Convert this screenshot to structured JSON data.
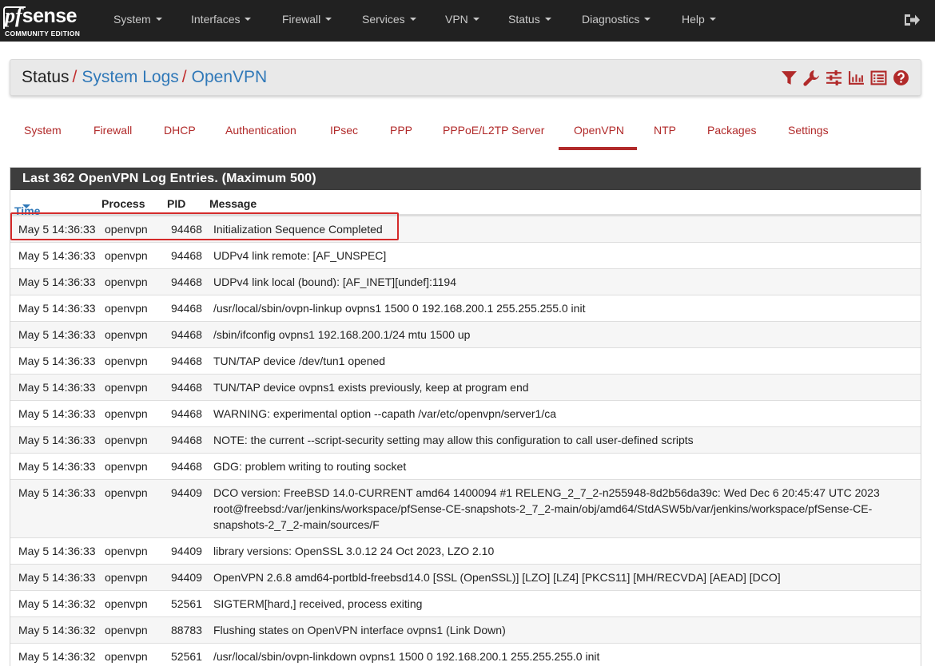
{
  "navbar": {
    "logo_main_pf": "pf",
    "logo_main_sense": "sense",
    "logo_sub": "COMMUNITY EDITION",
    "items": [
      "System",
      "Interfaces",
      "Firewall",
      "Services",
      "VPN",
      "Status",
      "Diagnostics",
      "Help"
    ],
    "logout_icon": "sign-out-icon"
  },
  "breadcrumb": {
    "root": "Status",
    "separator": "/",
    "level1": "System Logs",
    "level2": "OpenVPN",
    "icons": [
      "filter-icon",
      "wrench-icon",
      "sliders-icon",
      "bar-chart-icon",
      "list-icon",
      "question-circle-icon"
    ]
  },
  "tabs": {
    "items": [
      "System",
      "Firewall",
      "DHCP",
      "Authentication",
      "IPsec",
      "PPP",
      "PPPoE/L2TP Server",
      "OpenVPN",
      "NTP",
      "Packages",
      "Settings"
    ],
    "active": "OpenVPN"
  },
  "log": {
    "heading": "Last 362 OpenVPN Log Entries. (Maximum 500)",
    "columns": {
      "time": "Time",
      "process": "Process",
      "pid": "PID",
      "message": "Message"
    },
    "rows": [
      {
        "time": "May 5 14:36:33",
        "process": "openvpn",
        "pid": "94468",
        "message": "Initialization Sequence Completed"
      },
      {
        "time": "May 5 14:36:33",
        "process": "openvpn",
        "pid": "94468",
        "message": "UDPv4 link remote: [AF_UNSPEC]"
      },
      {
        "time": "May 5 14:36:33",
        "process": "openvpn",
        "pid": "94468",
        "message": "UDPv4 link local (bound): [AF_INET][undef]:1194"
      },
      {
        "time": "May 5 14:36:33",
        "process": "openvpn",
        "pid": "94468",
        "message": "/usr/local/sbin/ovpn-linkup ovpns1 1500 0 192.168.200.1 255.255.255.0 init"
      },
      {
        "time": "May 5 14:36:33",
        "process": "openvpn",
        "pid": "94468",
        "message": "/sbin/ifconfig ovpns1 192.168.200.1/24 mtu 1500 up"
      },
      {
        "time": "May 5 14:36:33",
        "process": "openvpn",
        "pid": "94468",
        "message": "TUN/TAP device /dev/tun1 opened"
      },
      {
        "time": "May 5 14:36:33",
        "process": "openvpn",
        "pid": "94468",
        "message": "TUN/TAP device ovpns1 exists previously, keep at program end"
      },
      {
        "time": "May 5 14:36:33",
        "process": "openvpn",
        "pid": "94468",
        "message": "WARNING: experimental option --capath /var/etc/openvpn/server1/ca"
      },
      {
        "time": "May 5 14:36:33",
        "process": "openvpn",
        "pid": "94468",
        "message": "NOTE: the current --script-security setting may allow this configuration to call user-defined scripts"
      },
      {
        "time": "May 5 14:36:33",
        "process": "openvpn",
        "pid": "94468",
        "message": "GDG: problem writing to routing socket"
      },
      {
        "time": "May 5 14:36:33",
        "process": "openvpn",
        "pid": "94409",
        "message": "DCO version: FreeBSD 14.0-CURRENT amd64 1400094 #1 RELENG_2_7_2-n255948-8d2b56da39c: Wed Dec 6 20:45:47 UTC 2023 root@freebsd:/var/jenkins/workspace/pfSense-CE-snapshots-2_7_2-main/obj/amd64/StdASW5b/var/jenkins/workspace/pfSense-CE-snapshots-2_7_2-main/sources/F"
      },
      {
        "time": "May 5 14:36:33",
        "process": "openvpn",
        "pid": "94409",
        "message": "library versions: OpenSSL 3.0.12 24 Oct 2023, LZO 2.10"
      },
      {
        "time": "May 5 14:36:33",
        "process": "openvpn",
        "pid": "94409",
        "message": "OpenVPN 2.6.8 amd64-portbld-freebsd14.0 [SSL (OpenSSL)] [LZO] [LZ4] [PKCS11] [MH/RECVDA] [AEAD] [DCO]"
      },
      {
        "time": "May 5 14:36:32",
        "process": "openvpn",
        "pid": "52561",
        "message": "SIGTERM[hard,] received, process exiting"
      },
      {
        "time": "May 5 14:36:32",
        "process": "openvpn",
        "pid": "88783",
        "message": "Flushing states on OpenVPN interface ovpns1 (Link Down)"
      },
      {
        "time": "May 5 14:36:32",
        "process": "openvpn",
        "pid": "52561",
        "message": "/usr/local/sbin/ovpn-linkdown ovpns1 1500 0 192.168.200.1 255.255.255.0 init"
      }
    ]
  },
  "colors": {
    "navbar_bg": "#212121",
    "accent_red": "#b12a2a",
    "link_blue": "#2f78b8",
    "highlight_red": "#d42a2a"
  }
}
